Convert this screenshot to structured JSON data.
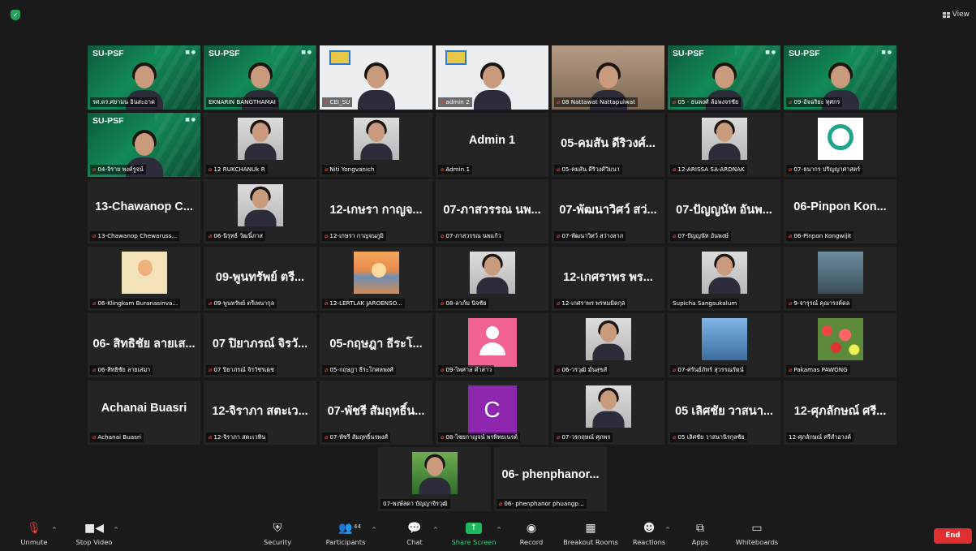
{
  "topbar": {
    "view_label": "View"
  },
  "brand_text": "SU-PSF",
  "tiles": [
    {
      "type": "video",
      "bg": "green",
      "brand": true,
      "label": "รศ.ดร.ศยามน อินสะอาด",
      "muted": false,
      "active": true
    },
    {
      "type": "video",
      "bg": "green",
      "brand": true,
      "label": "EKNARIN BANGTHAMAI",
      "muted": false
    },
    {
      "type": "video",
      "bg": "white",
      "label": "CEI_SU",
      "muted": true
    },
    {
      "type": "video",
      "bg": "white",
      "label": "admin 2",
      "muted": true
    },
    {
      "type": "video",
      "bg": "room",
      "label": "08 Nattawat Nattapulwat",
      "muted": true
    },
    {
      "type": "video",
      "bg": "green",
      "brand": true,
      "label": "05 - ธนพงศ์ ล้อพงจรชัย",
      "muted": true
    },
    {
      "type": "video",
      "bg": "green",
      "brand": true,
      "label": "09-อัจฉริยะ ทุศกร",
      "muted": true
    },
    {
      "type": "video",
      "bg": "green",
      "brand": true,
      "label": "04-จิราย พงค์รูจน์",
      "muted": true
    },
    {
      "type": "thumb",
      "img": "portrait",
      "label": "12 RUKCHANUk R",
      "muted": true
    },
    {
      "type": "thumb",
      "img": "portrait",
      "label": "Niti Yongvanich",
      "muted": true
    },
    {
      "type": "name",
      "name": "Admin 1",
      "label": "Admin 1",
      "muted": true
    },
    {
      "type": "name",
      "name": "05-คมสัน ดีริวงศ์...",
      "label": "05-คมสัน ดีริวงศ์วิมนา",
      "muted": true
    },
    {
      "type": "thumb",
      "img": "portrait",
      "label": "12-ARISSA SA-ARDNAK",
      "muted": true
    },
    {
      "type": "thumb",
      "img": "logo",
      "label": "07-ธนากร ปริญญาศาสตร์",
      "muted": true
    },
    {
      "type": "name",
      "name": "13-Chawanop C...",
      "label": "13-Chawanop Chewaruss...",
      "muted": true
    },
    {
      "type": "thumb",
      "img": "portrait",
      "label": "06-นิรุทธ์ วัฒนิ์ภาส",
      "muted": true
    },
    {
      "type": "name",
      "name": "12-เกษรา กาญจ...",
      "label": "12-เกษรา กาญจนภูมิ",
      "muted": true
    },
    {
      "type": "name",
      "name": "07-ภาสวรรณ นพ...",
      "label": "07-ภาสวรรณ นพแก้ว",
      "muted": true
    },
    {
      "type": "name",
      "name": "07-พัฒนาวิศว์ สว่...",
      "label": "07-พัฒนาวิศว์ สว่างลาภ",
      "muted": true
    },
    {
      "type": "name",
      "name": "07-ปัญญนัท อันพ...",
      "label": "07-ปัญญนัท อันพงษ์",
      "muted": true
    },
    {
      "type": "name",
      "name": "06-Pinpon Kon...",
      "label": "06-Pinpon Kongwijit",
      "muted": true
    },
    {
      "type": "thumb",
      "img": "cartoon",
      "label": "06-Klingkam Buranasinva...",
      "muted": true
    },
    {
      "type": "name",
      "name": "09-พูนทรัพย์ ตรี...",
      "label": "09-พูนทรัพย์ ตรีเพนากุล",
      "muted": true
    },
    {
      "type": "thumb",
      "img": "sunset",
      "label": "12-LERTLAK JAROENSO...",
      "muted": true
    },
    {
      "type": "thumb",
      "img": "portrait",
      "label": "08-ลาภ์ม นิจชัย",
      "muted": true
    },
    {
      "type": "name",
      "name": "12-เกศราพร พร...",
      "label": "12-เกศราพร พรหมมิดกุล",
      "muted": true
    },
    {
      "type": "thumb",
      "img": "portrait",
      "label": "Supicha Sangsukalum",
      "muted": false
    },
    {
      "type": "thumb",
      "img": "jarut",
      "label": "9-จารุรณ์ คุณารงค์ดล",
      "muted": true
    },
    {
      "type": "name",
      "name": "06- สิทธิชัย ลายเส...",
      "label": "06-สิทธิชัย ลายเสมา",
      "muted": true
    },
    {
      "type": "name",
      "name": "07 ปิยาภรณ์ จิรวั...",
      "label": "07 ปิยาภรณ์ จิรวัชรเดช",
      "muted": true
    },
    {
      "type": "name",
      "name": "05-กฤษฎา ธีระโ...",
      "label": "05-กฤษฎา ธีระโกศลพงศ์",
      "muted": true
    },
    {
      "type": "avatar-pink",
      "label": "09-ไพศาล คำสาว",
      "muted": true
    },
    {
      "type": "thumb",
      "img": "portrait",
      "label": "06-วรวุฒิ มั่นสุขสั",
      "muted": true
    },
    {
      "type": "thumb",
      "img": "sky",
      "label": "07-ศรันย์ภัทร์ สุวรรณรัตน์",
      "muted": true
    },
    {
      "type": "thumb",
      "img": "flowers",
      "label": "Pakamas PAWONG",
      "muted": true
    },
    {
      "type": "name",
      "name": "Achanai Buasri",
      "label": "Achanai Buasri",
      "muted": true
    },
    {
      "type": "name",
      "name": "12-จิราภา สตะเว...",
      "label": "12-จิราภา สตะเวทิน",
      "muted": true
    },
    {
      "type": "name",
      "name": "07-พัชรี สัมฤทธิ์น...",
      "label": "07-พัชรี สัมฤทธิ์นรพงศ์",
      "muted": true
    },
    {
      "type": "avatar-letter",
      "letter": "C",
      "label": "08-ไชยกาญจน์ พรพิทยเนรต์",
      "muted": true
    },
    {
      "type": "thumb",
      "img": "portrait",
      "label": "07-วรกฤษณ์ ศุภพร",
      "muted": true
    },
    {
      "type": "name",
      "name": "05 เลิศชัย วาสนา...",
      "label": "05 เลิศชัย วาสนานิรกุลชัย",
      "muted": true
    },
    {
      "type": "name",
      "name": "12-ศุภลักษณ์ ศรี...",
      "label": "12-ศุภลักษณ์ ศรีสำอางค์",
      "muted": false
    }
  ],
  "last_row": [
    {
      "type": "thumb",
      "img": "forest",
      "label": "07-พงษ์ลดา บัญญาจิรวุฒิ",
      "muted": false
    },
    {
      "type": "name",
      "name": "06- phenphanor...",
      "label": "06- phenphanor phuangp...",
      "muted": true
    }
  ],
  "toolbar": {
    "unmute": "Unmute",
    "stop_video": "Stop Video",
    "security": "Security",
    "participants": "Participants",
    "participants_count": "44",
    "chat": "Chat",
    "share_screen": "Share Screen",
    "record": "Record",
    "breakout_rooms": "Breakout Rooms",
    "reactions": "Reactions",
    "apps": "Apps",
    "whiteboards": "Whiteboards",
    "end": "End"
  },
  "colors": {
    "active_border": "#c7e36c",
    "share_green": "#1fd17b",
    "end_red": "#e02f2f",
    "muted_red": "#e0403a"
  }
}
